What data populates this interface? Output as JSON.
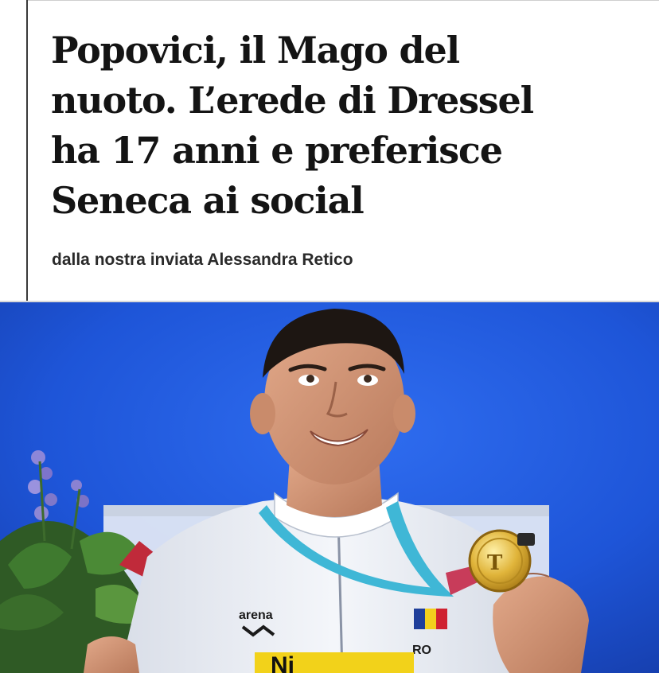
{
  "article": {
    "headline_lines": [
      "Popovici, il Mago del",
      "nuoto. L’erede di Dressel",
      "ha 17 anni e preferisce",
      "Seneca ai social"
    ],
    "byline": "dalla nostra inviata Alessandra Retico"
  },
  "photo": {
    "subject": "swimmer holding gold medal on podium",
    "jacket_brand": "arena",
    "bib_text": "RO",
    "banner_text": "Ni",
    "colors": {
      "background": "#1e55d8",
      "jacket": "#eef1f6",
      "lanyard": "#3fb7d6",
      "medal": "#e0b43a"
    }
  },
  "colors": {
    "headline": "#141414",
    "byline": "#2a2a2a",
    "rule": "#3a3a3a"
  }
}
